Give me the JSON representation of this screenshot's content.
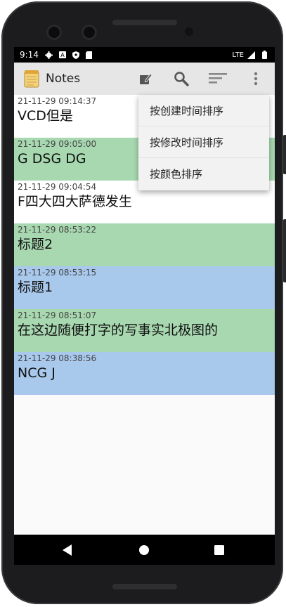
{
  "status_bar": {
    "time": "9:14",
    "network": "LTE"
  },
  "action_bar": {
    "title": "Notes",
    "icons": [
      "edit-icon",
      "search-icon",
      "sort-icon",
      "overflow-menu-icon"
    ]
  },
  "notes": [
    {
      "timestamp": "21-11-29 09:14:37",
      "title": "VCD但是",
      "color": "#ffffff"
    },
    {
      "timestamp": "21-11-29 09:05:00",
      "title": "G DSG DG",
      "color": "#a8d8b0"
    },
    {
      "timestamp": "21-11-29 09:04:54",
      "title": "F四大四大萨德发生",
      "color": "#ffffff"
    },
    {
      "timestamp": "21-11-29 08:53:22",
      "title": "标题2",
      "color": "#a8d8b0"
    },
    {
      "timestamp": "21-11-29 08:53:15",
      "title": "标题1",
      "color": "#a8c8ec"
    },
    {
      "timestamp": "21-11-29 08:51:07",
      "title": "在这边随便打字的写事实北极图的",
      "color": "#a8d8b0"
    },
    {
      "timestamp": "21-11-29 08:38:56",
      "title": "NCG J",
      "color": "#a8c8ec"
    }
  ],
  "sort_menu": {
    "items": [
      "按创建时间排序",
      "按修改时间排序",
      "按颜色排序"
    ]
  },
  "colors": {
    "action_bar_bg": "#e6e6e6",
    "green_note": "#a8d8b0",
    "blue_note": "#a8c8ec",
    "white_note": "#ffffff"
  }
}
